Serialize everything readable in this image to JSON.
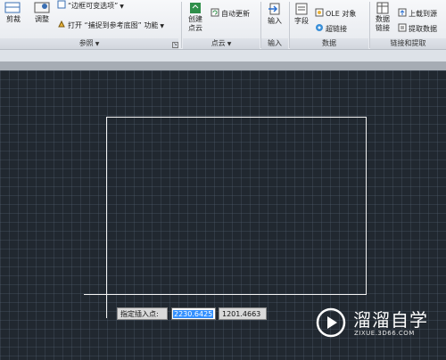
{
  "ribbon": {
    "reference_panel": {
      "title": "参照",
      "clip_label": "剪裁",
      "adjust_label": "调整",
      "frame_variable": "“边框可变选项”",
      "snap_ref": "打开 “捕捉到参考底图” 功能"
    },
    "pointcloud_panel": {
      "title": "点云",
      "create_label": "创建\n点云",
      "auto_update": "自动更新"
    },
    "import_panel": {
      "title": "输入",
      "import_label": "输入"
    },
    "data_panel": {
      "title": "数据",
      "field_label": "字段",
      "ole_label": "OLE 对象",
      "hyperlink_label": "超链接"
    },
    "link_panel": {
      "title": "链接和提取",
      "data_link_label": "数据\n链接",
      "upload_label": "上载到源",
      "extract_label": "提取数据"
    }
  },
  "dynamic_input": {
    "prompt": "指定插入点:",
    "x_value": "2230.6425",
    "y_value": "1201.4663"
  },
  "watermark": {
    "title": "溜溜自学",
    "subtitle": "ZIXUE.3D66.COM"
  },
  "colors": {
    "canvas_bg": "#212830",
    "selection": "#3390ff",
    "ribbon_bg": "#eef0f3"
  }
}
